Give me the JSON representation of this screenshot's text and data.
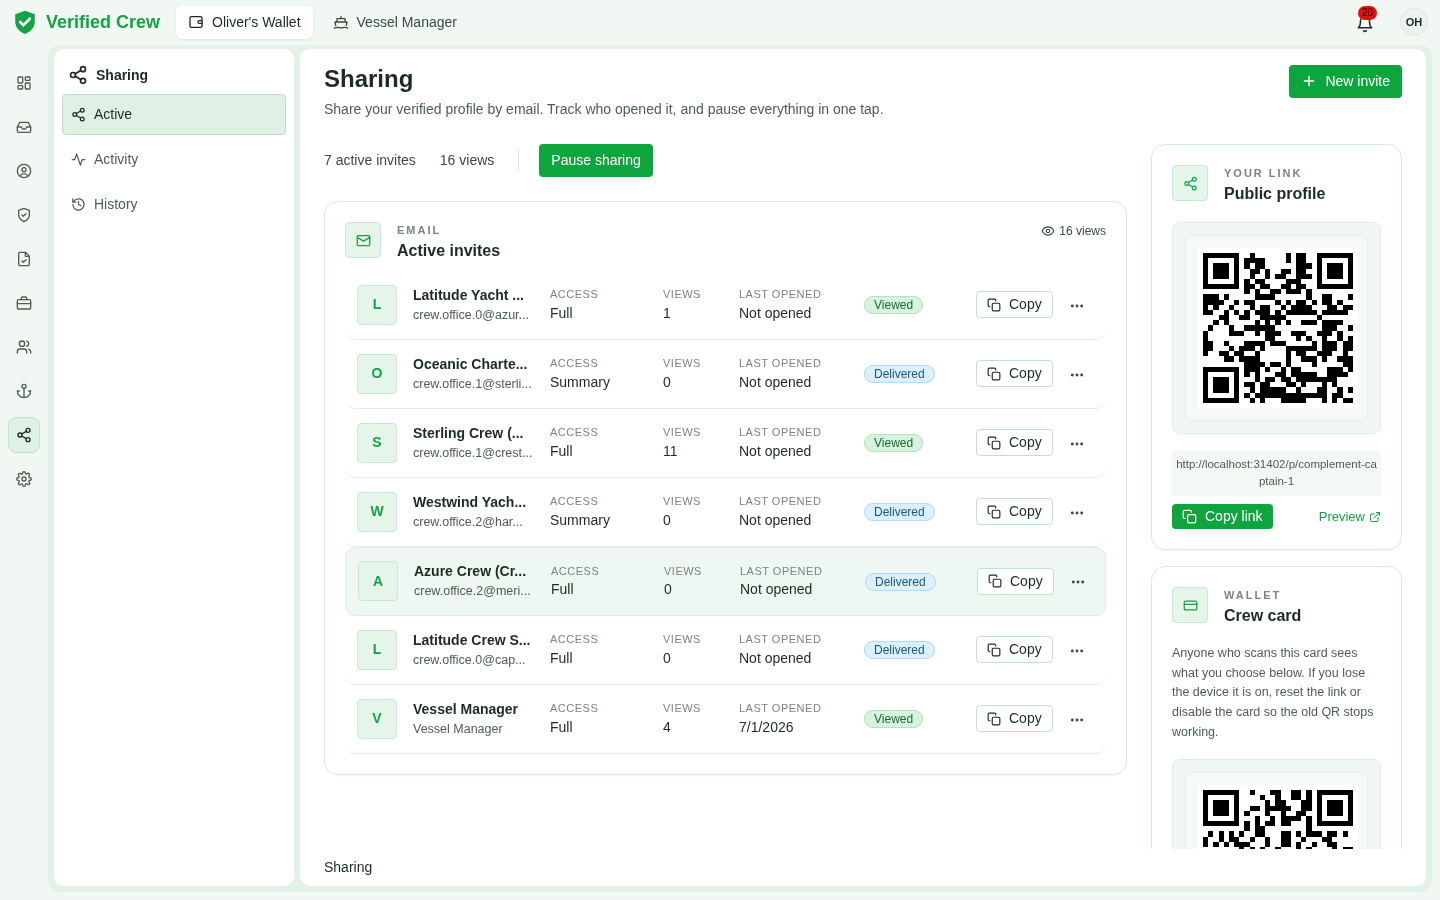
{
  "brand": {
    "name": "Verified Crew"
  },
  "top_tabs": [
    {
      "label": "Oliver's Wallet",
      "selected": true
    },
    {
      "label": "Vessel Manager",
      "selected": false
    }
  ],
  "notifications": {
    "count": "20"
  },
  "avatar": {
    "initials": "OH"
  },
  "rail": [
    {
      "selected": false
    },
    {
      "selected": false
    },
    {
      "selected": false
    },
    {
      "selected": false
    },
    {
      "selected": false
    },
    {
      "selected": false
    },
    {
      "selected": false
    },
    {
      "selected": false
    },
    {
      "selected": true
    },
    {
      "selected": false
    }
  ],
  "sidebar": {
    "title": "Sharing",
    "items": [
      {
        "label": "Active",
        "selected": true
      },
      {
        "label": "Activity",
        "selected": false
      },
      {
        "label": "History",
        "selected": false
      }
    ]
  },
  "page": {
    "title": "Sharing",
    "subtitle": "Share your verified profile by email. Track who opened it, and pause everything in one tap.",
    "new_button": "New invite",
    "stats": [
      "7 active invites",
      "16 views"
    ],
    "pause_button": "Pause sharing"
  },
  "invites": {
    "eyebrow": "EMAIL",
    "title": "Active invites",
    "views": "16 views",
    "rows": [
      {
        "initial": "L",
        "name": "Latitude Yacht ...",
        "email": "crew.office.0@azur...",
        "access_label": "ACCESS",
        "access": "Full",
        "views_label": "VIEWS",
        "views": "1",
        "opened_label": "LAST OPENED",
        "opened": "Not opened",
        "status": "Viewed",
        "kind": "viewed",
        "copy": "Copy",
        "highlighted": false
      },
      {
        "initial": "O",
        "name": "Oceanic Charte...",
        "email": "crew.office.1@sterli...",
        "access_label": "ACCESS",
        "access": "Summary",
        "views_label": "VIEWS",
        "views": "0",
        "opened_label": "LAST OPENED",
        "opened": "Not opened",
        "status": "Delivered",
        "kind": "delivered",
        "copy": "Copy",
        "highlighted": false
      },
      {
        "initial": "S",
        "name": "Sterling Crew (...",
        "email": "crew.office.1@crest...",
        "access_label": "ACCESS",
        "access": "Full",
        "views_label": "VIEWS",
        "views": "11",
        "opened_label": "LAST OPENED",
        "opened": "Not opened",
        "status": "Viewed",
        "kind": "viewed",
        "copy": "Copy",
        "highlighted": false
      },
      {
        "initial": "W",
        "name": "Westwind Yach...",
        "email": "crew.office.2@har...",
        "access_label": "ACCESS",
        "access": "Summary",
        "views_label": "VIEWS",
        "views": "0",
        "opened_label": "LAST OPENED",
        "opened": "Not opened",
        "status": "Delivered",
        "kind": "delivered",
        "copy": "Copy",
        "highlighted": false
      },
      {
        "initial": "A",
        "name": "Azure Crew (Cr...",
        "email": "crew.office.2@meri...",
        "access_label": "ACCESS",
        "access": "Full",
        "views_label": "VIEWS",
        "views": "0",
        "opened_label": "LAST OPENED",
        "opened": "Not opened",
        "status": "Delivered",
        "kind": "delivered",
        "copy": "Copy",
        "highlighted": true
      },
      {
        "initial": "L",
        "name": "Latitude Crew S...",
        "email": "crew.office.0@cap...",
        "access_label": "ACCESS",
        "access": "Full",
        "views_label": "VIEWS",
        "views": "0",
        "opened_label": "LAST OPENED",
        "opened": "Not opened",
        "status": "Delivered",
        "kind": "delivered",
        "copy": "Copy",
        "highlighted": false
      },
      {
        "initial": "V",
        "name": "Vessel Manager",
        "email": "Vessel Manager",
        "access_label": "ACCESS",
        "access": "Full",
        "views_label": "VIEWS",
        "views": "4",
        "opened_label": "LAST OPENED",
        "opened": "7/1/2026",
        "status": "Viewed",
        "kind": "viewed",
        "copy": "Copy",
        "highlighted": false
      }
    ]
  },
  "link_card": {
    "eyebrow": "YOUR LINK",
    "title": "Public profile",
    "url": "http://localhost:31402/p/complement-captain-1",
    "copy_button": "Copy link",
    "preview": "Preview"
  },
  "wallet_card": {
    "eyebrow": "WALLET",
    "title": "Crew card",
    "text": "Anyone who scans this card sees what you choose below. If you lose the device it is on, reset the link or disable the card so the old QR stops working."
  },
  "footer": "Sharing"
}
